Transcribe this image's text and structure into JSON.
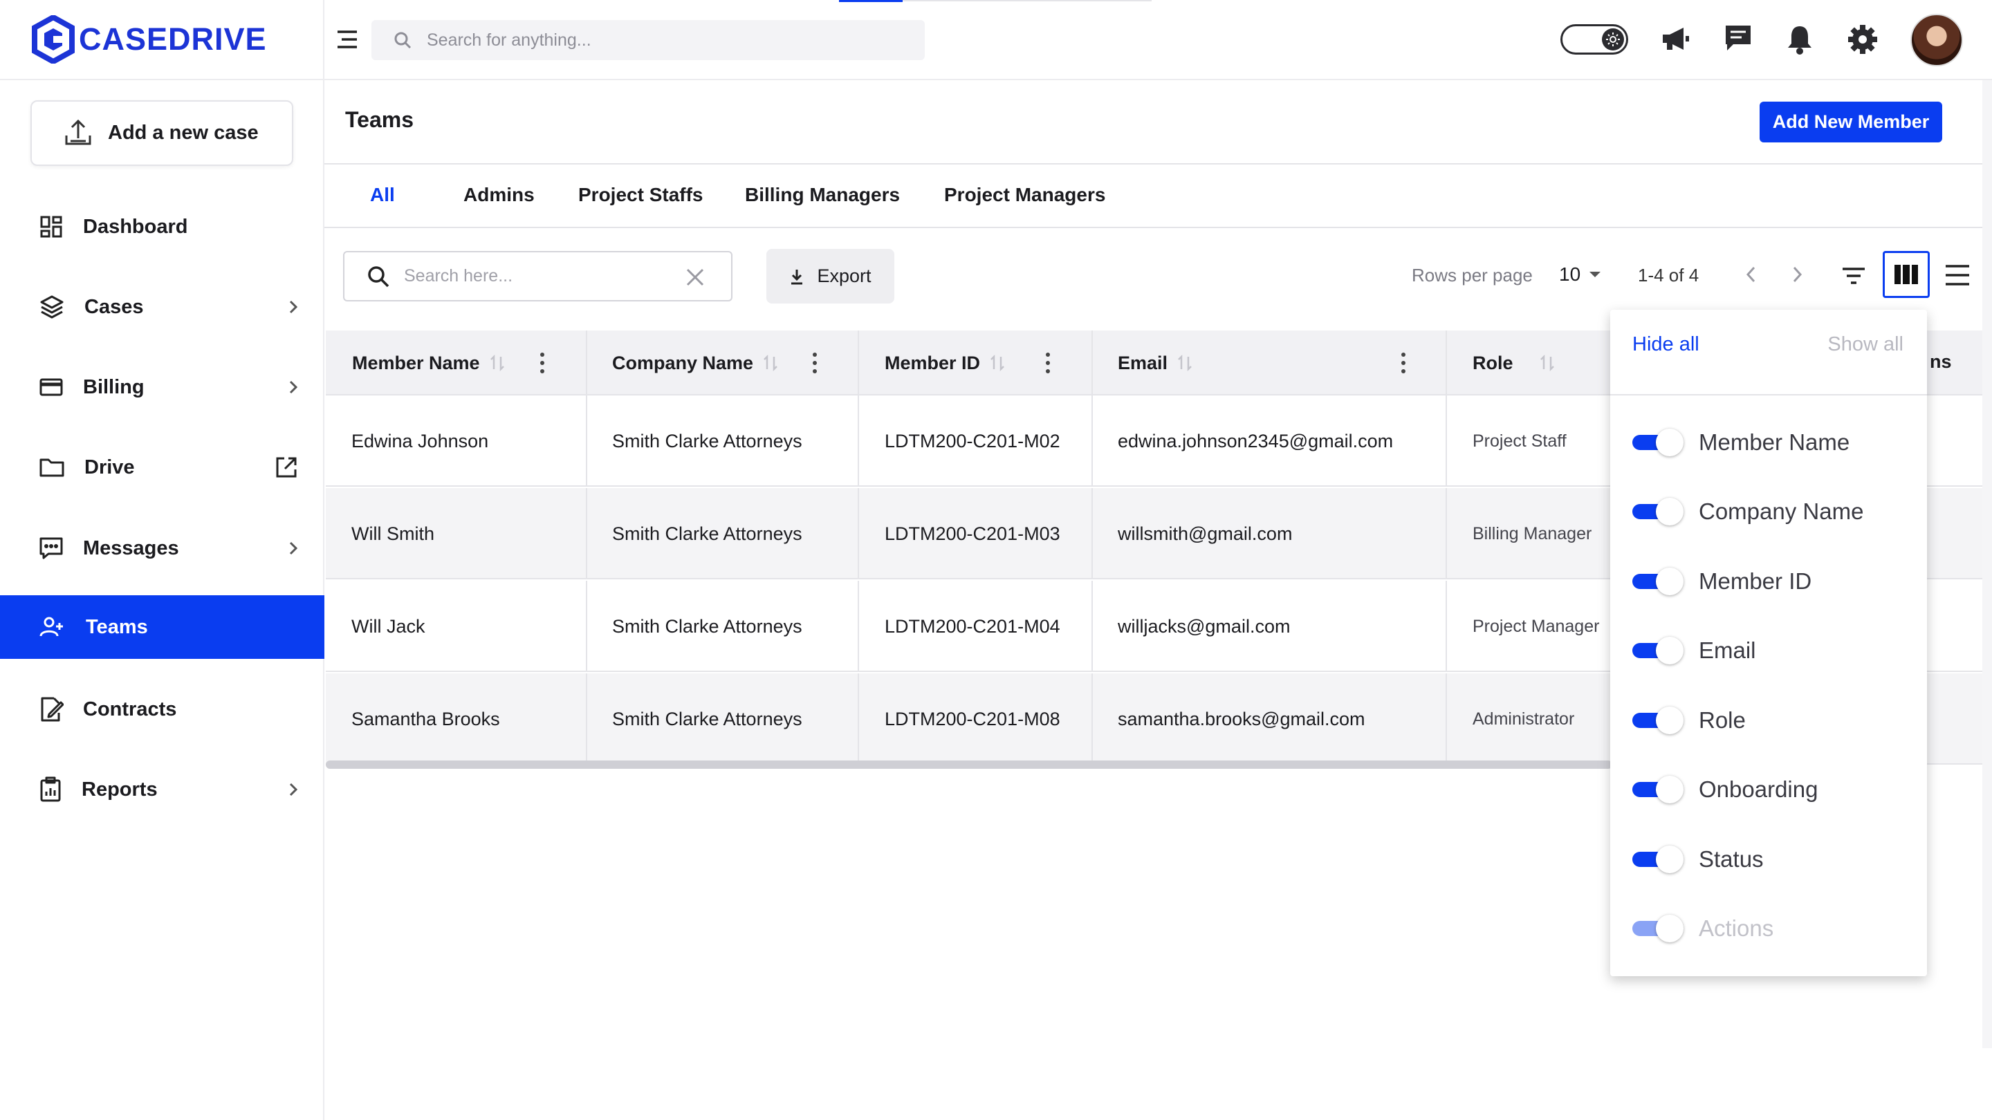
{
  "brand": {
    "name": "CASEDRIVE",
    "color": "#1c34d6"
  },
  "colors": {
    "accent": "#0a3df0",
    "row_alt": "#f4f4f6"
  },
  "topbar": {
    "search_placeholder": "Search for anything...",
    "icons": [
      "menu-icon",
      "theme-toggle-icon",
      "megaphone-icon",
      "chat-icon",
      "bell-icon",
      "gear-icon"
    ]
  },
  "sidebar": {
    "add_case": "Add a new case",
    "items": [
      {
        "label": "Dashboard",
        "icon": "dashboard-icon"
      },
      {
        "label": "Cases",
        "icon": "layers-icon"
      },
      {
        "label": "Billing",
        "icon": "card-icon"
      },
      {
        "label": "Drive",
        "icon": "folder-icon"
      },
      {
        "label": "Messages",
        "icon": "message-icon"
      },
      {
        "label": "Teams",
        "icon": "team-icon",
        "active": true
      },
      {
        "label": "Contracts",
        "icon": "contract-icon"
      },
      {
        "label": "Reports",
        "icon": "report-icon"
      }
    ]
  },
  "page": {
    "title": "Teams",
    "add_button": "Add New Member",
    "tabs": [
      "All",
      "Admins",
      "Project Staffs",
      "Billing Managers",
      "Project Managers"
    ],
    "active_tab": "All"
  },
  "toolbar": {
    "search_placeholder": "Search here...",
    "export_label": "Export",
    "rows_per_page_label": "Rows per page",
    "rows_per_page": "10",
    "range": "1-4 of 4"
  },
  "table": {
    "columns": [
      "Member Name",
      "Company Name",
      "Member ID",
      "Email",
      "Role"
    ],
    "rows": [
      [
        "Edwina Johnson",
        "Smith Clarke Attorneys",
        "LDTM200-C201-M02",
        "edwina.johnson2345@gmail.com",
        "Project Staff"
      ],
      [
        "Will Smith",
        "Smith Clarke Attorneys",
        "LDTM200-C201-M03",
        "willsmith@gmail.com",
        "Billing Manager"
      ],
      [
        "Will Jack",
        "Smith Clarke Attorneys",
        "LDTM200-C201-M04",
        "willjacks@gmail.com",
        "Project Manager"
      ],
      [
        "Samantha Brooks",
        "Smith Clarke Attorneys",
        "LDTM200-C201-M08",
        "samantha.brooks@gmail.com",
        "Administrator"
      ]
    ],
    "peek_header": "ns"
  },
  "columns_panel": {
    "hide_all": "Hide all",
    "show_all": "Show all",
    "options": [
      {
        "label": "Member Name",
        "on": true
      },
      {
        "label": "Company Name",
        "on": true
      },
      {
        "label": "Member ID",
        "on": true
      },
      {
        "label": "Email",
        "on": true
      },
      {
        "label": "Role",
        "on": true
      },
      {
        "label": "Onboarding",
        "on": true
      },
      {
        "label": "Status",
        "on": true
      },
      {
        "label": "Actions",
        "on": true,
        "disabled": true
      }
    ]
  }
}
